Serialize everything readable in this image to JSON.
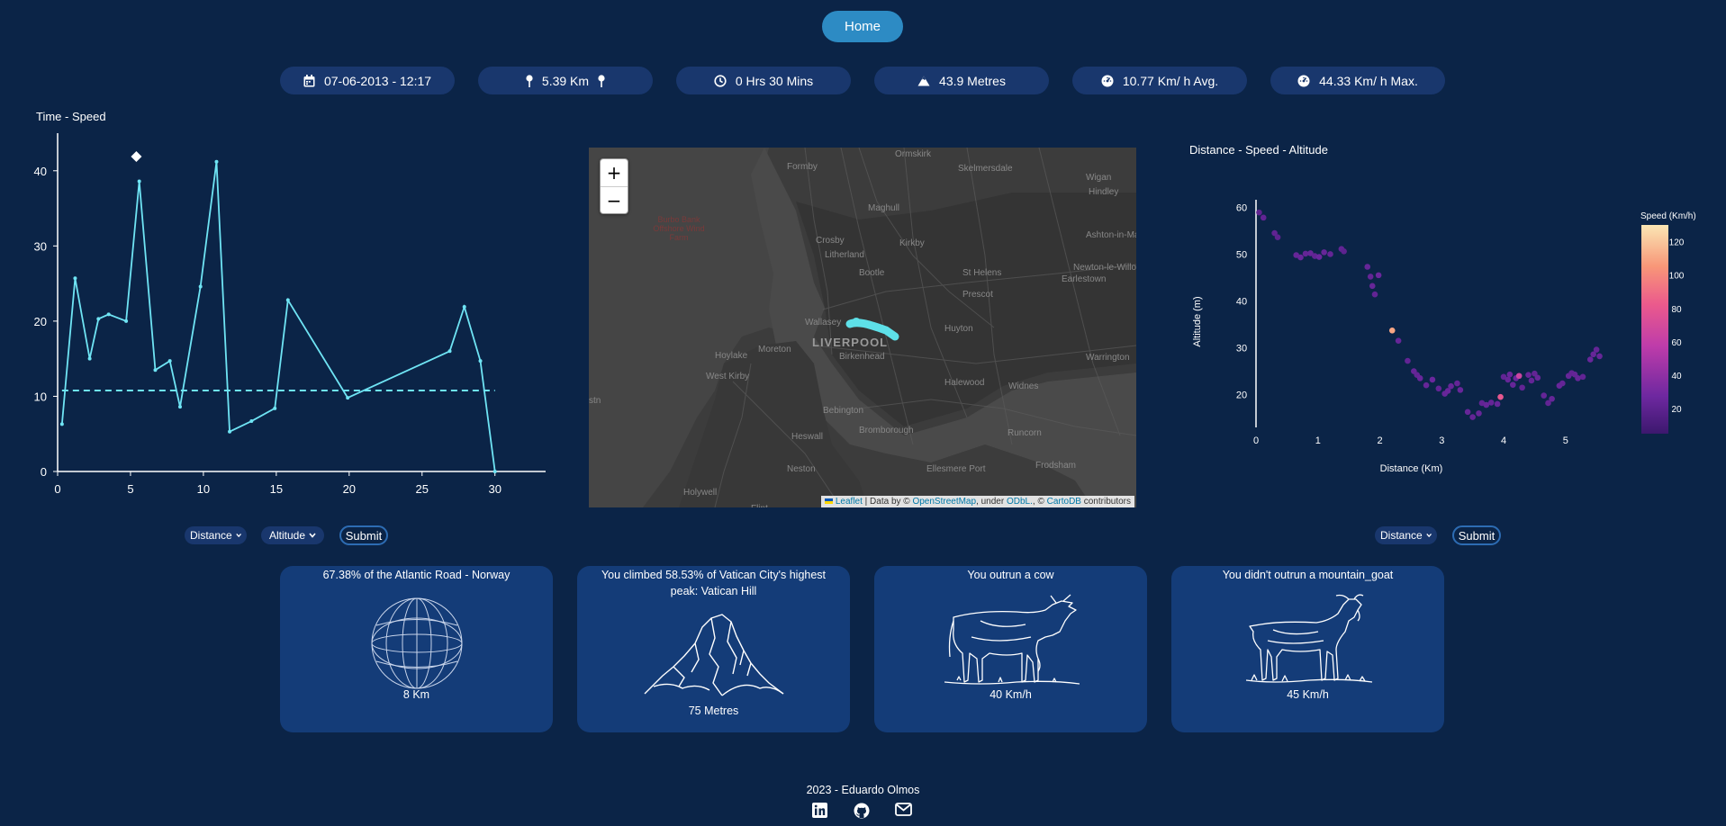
{
  "nav": {
    "home_label": "Home"
  },
  "stats": [
    {
      "icon": "calendar-icon",
      "text": "07-06-2013 - 12:17"
    },
    {
      "icon": "pin-icon",
      "text": "5.39 Km"
    },
    {
      "icon": "clock-icon",
      "text": "0 Hrs 30 Mins"
    },
    {
      "icon": "mountain-icon",
      "text": "43.9 Metres"
    },
    {
      "icon": "gauge-icon",
      "text": "10.77 Km/ h Avg."
    },
    {
      "icon": "gauge-icon",
      "text": "44.33 Km/ h Max."
    }
  ],
  "chart_data": [
    {
      "type": "line",
      "title": "Time - Speed",
      "x": [
        0.3,
        1.2,
        2.2,
        2.8,
        3.5,
        4.7,
        5.6,
        6.7,
        7.7,
        8.4,
        9.8,
        10.9,
        11.8,
        13.3,
        14.9,
        15.8,
        19.9,
        26.9,
        27.9,
        29.0,
        30.0
      ],
      "y": [
        6.3,
        25.7,
        15.0,
        20.3,
        20.9,
        20.0,
        38.6,
        13.5,
        14.7,
        8.6,
        24.6,
        41.2,
        5.3,
        6.7,
        8.4,
        22.8,
        9.8,
        16.0,
        21.9,
        14.7,
        0.0
      ],
      "reference_line": 10.77,
      "xticks": [
        "0",
        "5",
        "10",
        "15",
        "20",
        "25",
        "30"
      ],
      "yticks": [
        "0",
        "10",
        "20",
        "30",
        "40"
      ],
      "xlim": [
        0,
        31.5
      ],
      "ylim": [
        0,
        45
      ],
      "line_color": "#6fe4f4"
    },
    {
      "type": "scatter",
      "title": "Distance - Speed - Altitude",
      "xlabel": "Distance (Km)",
      "ylabel": "Altitude (m)",
      "colorbar_label": "Speed (Km/h)",
      "colorbar_ticks": [
        "20",
        "40",
        "60",
        "80",
        "100",
        "120"
      ],
      "xticks": [
        "0",
        "1",
        "2",
        "3",
        "4",
        "5"
      ],
      "yticks": [
        "20",
        "30",
        "40",
        "50",
        "60"
      ],
      "xlim": [
        0,
        5.6
      ],
      "ylim": [
        13,
        62
      ],
      "points": [
        {
          "x": 0.05,
          "y": 58.9,
          "s": 20
        },
        {
          "x": 0.12,
          "y": 57.8,
          "s": 22
        },
        {
          "x": 0.3,
          "y": 54.5,
          "s": 21
        },
        {
          "x": 0.35,
          "y": 53.6,
          "s": 20
        },
        {
          "x": 0.65,
          "y": 49.8,
          "s": 24
        },
        {
          "x": 0.72,
          "y": 49.3,
          "s": 25
        },
        {
          "x": 0.8,
          "y": 50.1,
          "s": 23
        },
        {
          "x": 0.88,
          "y": 50.2,
          "s": 24
        },
        {
          "x": 0.95,
          "y": 49.6,
          "s": 22
        },
        {
          "x": 1.02,
          "y": 49.4,
          "s": 26
        },
        {
          "x": 1.1,
          "y": 50.4,
          "s": 24
        },
        {
          "x": 1.2,
          "y": 50.0,
          "s": 23
        },
        {
          "x": 1.38,
          "y": 51.1,
          "s": 22
        },
        {
          "x": 1.42,
          "y": 50.6,
          "s": 20
        },
        {
          "x": 1.8,
          "y": 47.3,
          "s": 24
        },
        {
          "x": 1.85,
          "y": 45.2,
          "s": 23
        },
        {
          "x": 1.88,
          "y": 43.2,
          "s": 24
        },
        {
          "x": 1.92,
          "y": 41.4,
          "s": 22
        },
        {
          "x": 1.98,
          "y": 45.5,
          "s": 26
        },
        {
          "x": 2.2,
          "y": 33.7,
          "s": 110
        },
        {
          "x": 2.3,
          "y": 31.5,
          "s": 24
        },
        {
          "x": 2.45,
          "y": 27.2,
          "s": 22
        },
        {
          "x": 2.55,
          "y": 25.0,
          "s": 24
        },
        {
          "x": 2.6,
          "y": 24.2,
          "s": 23
        },
        {
          "x": 2.65,
          "y": 23.5,
          "s": 25
        },
        {
          "x": 2.75,
          "y": 22.0,
          "s": 24
        },
        {
          "x": 2.85,
          "y": 23.2,
          "s": 26
        },
        {
          "x": 2.95,
          "y": 21.3,
          "s": 22
        },
        {
          "x": 3.05,
          "y": 20.2,
          "s": 24
        },
        {
          "x": 3.1,
          "y": 20.8,
          "s": 25
        },
        {
          "x": 3.15,
          "y": 21.8,
          "s": 24
        },
        {
          "x": 3.25,
          "y": 22.4,
          "s": 23
        },
        {
          "x": 3.3,
          "y": 21.0,
          "s": 25
        },
        {
          "x": 3.42,
          "y": 16.3,
          "s": 24
        },
        {
          "x": 3.5,
          "y": 15.2,
          "s": 23
        },
        {
          "x": 3.6,
          "y": 16.0,
          "s": 24
        },
        {
          "x": 3.65,
          "y": 18.2,
          "s": 22
        },
        {
          "x": 3.72,
          "y": 17.8,
          "s": 24
        },
        {
          "x": 3.8,
          "y": 18.3,
          "s": 23
        },
        {
          "x": 3.9,
          "y": 18.0,
          "s": 24
        },
        {
          "x": 3.95,
          "y": 19.5,
          "s": 80
        },
        {
          "x": 4.0,
          "y": 23.8,
          "s": 22
        },
        {
          "x": 4.07,
          "y": 23.2,
          "s": 24
        },
        {
          "x": 4.1,
          "y": 24.3,
          "s": 25
        },
        {
          "x": 4.15,
          "y": 22.1,
          "s": 24
        },
        {
          "x": 4.2,
          "y": 23.5,
          "s": 26
        },
        {
          "x": 4.25,
          "y": 24.0,
          "s": 65
        },
        {
          "x": 4.3,
          "y": 21.5,
          "s": 22
        },
        {
          "x": 4.4,
          "y": 24.2,
          "s": 24
        },
        {
          "x": 4.45,
          "y": 23.0,
          "s": 23
        },
        {
          "x": 4.5,
          "y": 24.5,
          "s": 22
        },
        {
          "x": 4.55,
          "y": 23.6,
          "s": 24
        },
        {
          "x": 4.65,
          "y": 19.8,
          "s": 23
        },
        {
          "x": 4.72,
          "y": 18.2,
          "s": 22
        },
        {
          "x": 4.78,
          "y": 19.1,
          "s": 24
        },
        {
          "x": 4.9,
          "y": 21.9,
          "s": 25
        },
        {
          "x": 4.95,
          "y": 22.4,
          "s": 23
        },
        {
          "x": 5.05,
          "y": 24.0,
          "s": 24
        },
        {
          "x": 5.1,
          "y": 24.6,
          "s": 22
        },
        {
          "x": 5.15,
          "y": 24.3,
          "s": 23
        },
        {
          "x": 5.2,
          "y": 23.5,
          "s": 24
        },
        {
          "x": 5.28,
          "y": 23.8,
          "s": 22
        },
        {
          "x": 5.4,
          "y": 27.5,
          "s": 25
        },
        {
          "x": 5.45,
          "y": 28.6,
          "s": 24
        },
        {
          "x": 5.5,
          "y": 29.6,
          "s": 23
        },
        {
          "x": 5.55,
          "y": 28.2,
          "s": 24
        }
      ]
    }
  ],
  "map": {
    "zoom_in": "+",
    "zoom_out": "−",
    "attribution": {
      "leaflet": "Leaflet",
      "data_by": "| Data by ©",
      "osm": "OpenStreetMap",
      "under": ", under",
      "odbl": "ODbL.",
      "sep": ", ©",
      "cartodb": "CartoDB",
      "contributors": "contributors"
    },
    "labels": [
      {
        "text": "Ormskirk",
        "c": "#888"
      },
      {
        "text": "Formby",
        "c": "#888"
      },
      {
        "text": "Skelmersdale",
        "c": "#888"
      },
      {
        "text": "Wigan",
        "c": "#888"
      },
      {
        "text": "Hindley",
        "c": "#888"
      },
      {
        "text": "Maghull",
        "c": "#888"
      },
      {
        "text": "Crosby",
        "c": "#888"
      },
      {
        "text": "Kirkby",
        "c": "#888"
      },
      {
        "text": "Ashton-in-Makerfield",
        "c": "#888"
      },
      {
        "text": "Litherland",
        "c": "#888"
      },
      {
        "text": "St Helens",
        "c": "#888"
      },
      {
        "text": "Newton-le-Willows",
        "c": "#888"
      },
      {
        "text": "Earlestown",
        "c": "#888"
      },
      {
        "text": "Bootle",
        "c": "#888"
      },
      {
        "text": "Prescot",
        "c": "#888"
      },
      {
        "text": "Wallasey",
        "c": "#888"
      },
      {
        "text": "LIVERPOOL",
        "c": "#999"
      },
      {
        "text": "Huyton",
        "c": "#888"
      },
      {
        "text": "Hoylake",
        "c": "#888"
      },
      {
        "text": "Moreton",
        "c": "#888"
      },
      {
        "text": "Birkenhead",
        "c": "#888"
      },
      {
        "text": "West Kirby",
        "c": "#888"
      },
      {
        "text": "Halewood",
        "c": "#888"
      },
      {
        "text": "Widnes",
        "c": "#888"
      },
      {
        "text": "Warrington",
        "c": "#888"
      },
      {
        "text": "Bebington",
        "c": "#888"
      },
      {
        "text": "Heswall",
        "c": "#888"
      },
      {
        "text": "Bromborough",
        "c": "#888"
      },
      {
        "text": "Runcorn",
        "c": "#888"
      },
      {
        "text": "Neston",
        "c": "#888"
      },
      {
        "text": "Frodsham",
        "c": "#888"
      },
      {
        "text": "Ellesmere Port",
        "c": "#888"
      },
      {
        "text": "Holywell",
        "c": "#888"
      },
      {
        "text": "Flint",
        "c": "#888"
      },
      {
        "text": "Burbo Bank Offshore Wind Farm",
        "c": "#7a3a3a"
      },
      {
        "text": "stn",
        "c": "#888"
      }
    ]
  },
  "left_controls": {
    "x_select": "Distance",
    "y_select": "Altitude",
    "submit": "Submit"
  },
  "right_controls": {
    "select": "Distance",
    "submit": "Submit"
  },
  "cards": [
    {
      "title": "67.38% of the Atlantic Road - Norway",
      "value": "8 Km",
      "icon": "globe-icon"
    },
    {
      "title": "You climbed 58.53% of Vatican City's highest peak: Vatican Hill",
      "value": "75 Metres",
      "icon": "mountain-illustration-icon"
    },
    {
      "title": "You outrun a cow",
      "value": "40 Km/h",
      "icon": "cow-illustration-icon"
    },
    {
      "title": "You didn't outrun a mountain_goat",
      "value": "45 Km/h",
      "icon": "goat-illustration-icon"
    }
  ],
  "footer": {
    "text": "2023 - Eduardo Olmos",
    "links": [
      "linkedin-icon",
      "github-icon",
      "mail-icon"
    ]
  },
  "colors": {
    "background": "#0b2447",
    "pill": "#19376d",
    "card": "#143c78",
    "accent": "#2d8bc4"
  }
}
